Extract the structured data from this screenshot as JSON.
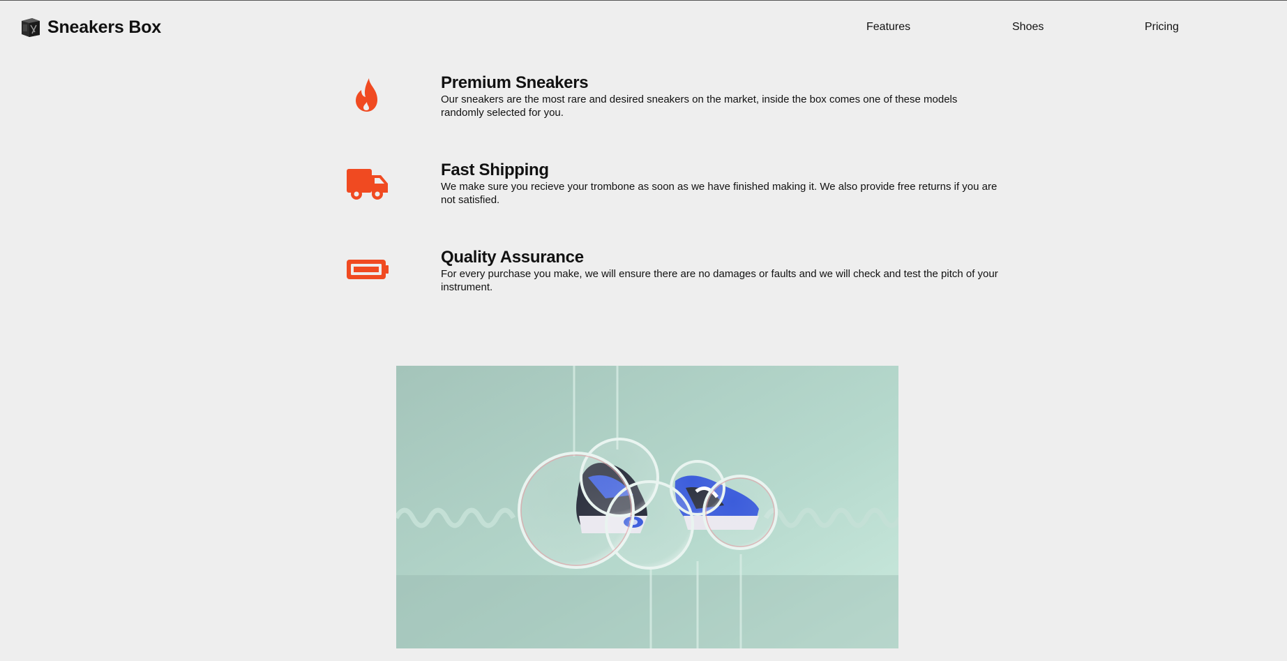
{
  "header": {
    "brand": "Sneakers Box",
    "nav": [
      {
        "label": "Features"
      },
      {
        "label": "Shoes"
      },
      {
        "label": "Pricing"
      }
    ]
  },
  "features": [
    {
      "icon": "fire-icon",
      "title": "Premium Sneakers",
      "description": "Our sneakers are the most rare and desired sneakers on the market, inside the box comes one of these models randomly selected for you."
    },
    {
      "icon": "truck-icon",
      "title": "Fast Shipping",
      "description": "We make sure you recieve your trombone as soon as we have finished making it. We also provide free returns if you are not satisfied."
    },
    {
      "icon": "battery-icon",
      "title": "Quality Assurance",
      "description": "For every purchase you make, we will ensure there are no damages or faults and we will check and test the pitch of your instrument."
    }
  ],
  "colors": {
    "accent": "#f04a21",
    "background": "#eeeeee",
    "video_bg": "#b0d3c8"
  }
}
